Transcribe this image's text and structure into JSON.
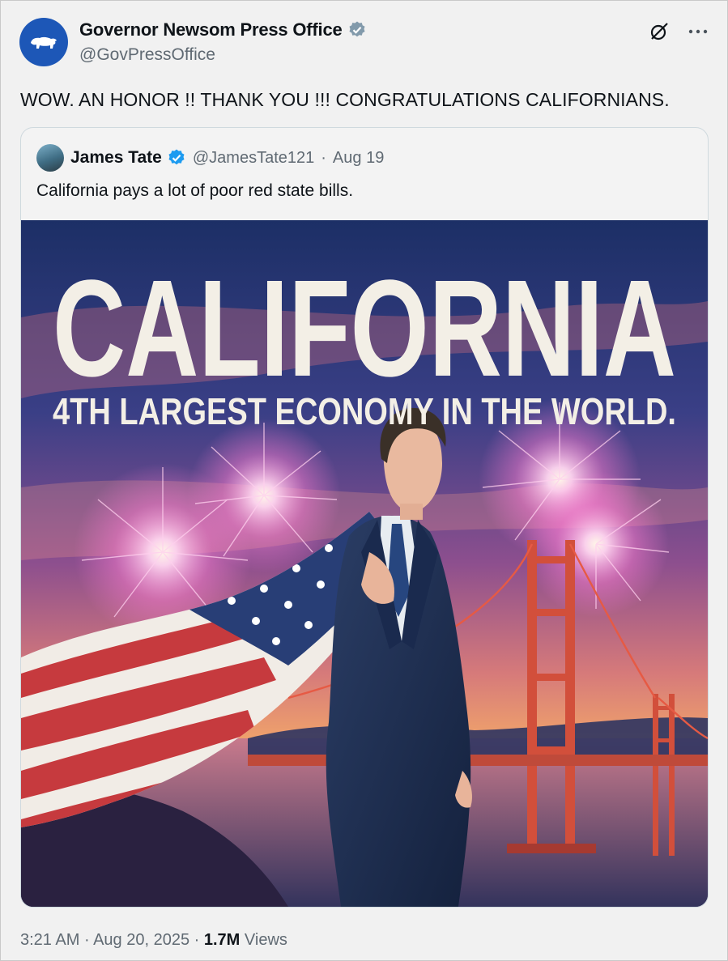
{
  "post": {
    "author_name": "Governor Newsom Press Office",
    "author_handle": "@GovPressOffice",
    "text": "WOW. AN HONOR !! THANK YOU !!! CONGRATULATIONS CALIFORNIANS.",
    "time": "3:21 AM",
    "date": "Aug 20, 2025",
    "views_count": "1.7M",
    "views_label": "Views",
    "separator": "·"
  },
  "quoted": {
    "author_name": "James Tate",
    "author_handle": "@JamesTate121",
    "separator": "·",
    "date": "Aug 19",
    "text": "California pays a lot of poor red state bills.",
    "image": {
      "headline": "CALIFORNIA",
      "subheadline": "4TH LARGEST ECONOMY IN THE WORLD."
    }
  },
  "icons": {
    "verified": "verified-badge-icon",
    "grok": "grok-icon",
    "more": "more-icon",
    "logo": "california-bear-icon"
  },
  "colors": {
    "verified": "#1d9bf0",
    "avatar_bg": "#1d57b7",
    "secondary_text": "#606a73"
  }
}
